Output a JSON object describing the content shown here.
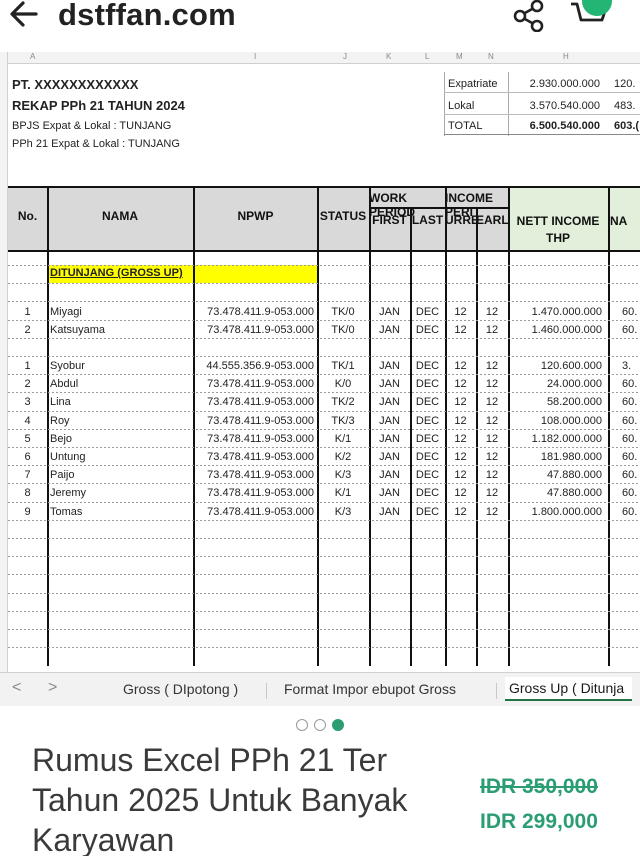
{
  "topbar": {
    "back_icon": "arrow-left-icon",
    "site": "dstffan.com",
    "share_icon": "share-icon",
    "cart_icon": "cart-icon"
  },
  "sheet": {
    "column_letters": [
      "A",
      "I",
      "J",
      "K",
      "L",
      "M",
      "N",
      "H"
    ],
    "company": "PT. XXXXXXXXXXXX",
    "report_title": "REKAP PPh 21 TAHUN 2024",
    "note1": "BPJS Expat & Lokal : TUNJANG",
    "note2": "PPh 21 Expat & Lokal : TUNJANG",
    "summary": [
      {
        "label": "Expatriate",
        "value": "2.930.000.000",
        "value2": "120."
      },
      {
        "label": "Lokal",
        "value": "3.570.540.000",
        "value2": "483."
      },
      {
        "label": "TOTAL",
        "value": "6.500.540.000",
        "value2": "603.("
      }
    ],
    "headers": {
      "no": "No.",
      "nama": "NAMA",
      "npwp": "NPWP",
      "status": "STATUS",
      "work_period": "WORK PERIOD",
      "first": "FIRST",
      "last": "LAST",
      "income_period": "INCOME PERI",
      "current": "URREN",
      "earlier": "EARLI",
      "nett_income": "NETT INCOME",
      "thp": "THP",
      "na": "NA"
    },
    "section_label": "DITUNJANG (GROSS UP)",
    "expat_rows": [
      {
        "no": "1",
        "nama": "Miyagi",
        "npwp": "73.478.411.9-053.000",
        "status": "TK/0",
        "first": "JAN",
        "last": "DEC",
        "cur": "12",
        "earl": "12",
        "nett": "1.470.000.000",
        "na": "60."
      },
      {
        "no": "2",
        "nama": "Katsuyama",
        "npwp": "73.478.411.9-053.000",
        "status": "TK/0",
        "first": "JAN",
        "last": "DEC",
        "cur": "12",
        "earl": "12",
        "nett": "1.460.000.000",
        "na": "60."
      }
    ],
    "local_rows": [
      {
        "no": "1",
        "nama": "Syobur",
        "npwp": "44.555.356.9-053.000",
        "status": "TK/1",
        "first": "JAN",
        "last": "DEC",
        "cur": "12",
        "earl": "12",
        "nett": "120.600.000",
        "na": "3."
      },
      {
        "no": "2",
        "nama": "Abdul",
        "npwp": "73.478.411.9-053.000",
        "status": "K/0",
        "first": "JAN",
        "last": "DEC",
        "cur": "12",
        "earl": "12",
        "nett": "24.000.000",
        "na": "60."
      },
      {
        "no": "3",
        "nama": "Lina",
        "npwp": "73.478.411.9-053.000",
        "status": "TK/2",
        "first": "JAN",
        "last": "DEC",
        "cur": "12",
        "earl": "12",
        "nett": "58.200.000",
        "na": "60."
      },
      {
        "no": "4",
        "nama": "Roy",
        "npwp": "73.478.411.9-053.000",
        "status": "TK/3",
        "first": "JAN",
        "last": "DEC",
        "cur": "12",
        "earl": "12",
        "nett": "108.000.000",
        "na": "60."
      },
      {
        "no": "5",
        "nama": "Bejo",
        "npwp": "73.478.411.9-053.000",
        "status": "K/1",
        "first": "JAN",
        "last": "DEC",
        "cur": "12",
        "earl": "12",
        "nett": "1.182.000.000",
        "na": "60."
      },
      {
        "no": "6",
        "nama": "Untung",
        "npwp": "73.478.411.9-053.000",
        "status": "K/2",
        "first": "JAN",
        "last": "DEC",
        "cur": "12",
        "earl": "12",
        "nett": "181.980.000",
        "na": "60."
      },
      {
        "no": "7",
        "nama": "Paijo",
        "npwp": "73.478.411.9-053.000",
        "status": "K/3",
        "first": "JAN",
        "last": "DEC",
        "cur": "12",
        "earl": "12",
        "nett": "47.880.000",
        "na": "60."
      },
      {
        "no": "8",
        "nama": "Jeremy",
        "npwp": "73.478.411.9-053.000",
        "status": "K/1",
        "first": "JAN",
        "last": "DEC",
        "cur": "12",
        "earl": "12",
        "nett": "47.880.000",
        "na": "60."
      },
      {
        "no": "9",
        "nama": "Tomas",
        "npwp": "73.478.411.9-053.000",
        "status": "K/3",
        "first": "JAN",
        "last": "DEC",
        "cur": "12",
        "earl": "12",
        "nett": "1.800.000.000",
        "na": "60."
      }
    ]
  },
  "tabs": {
    "prev": "<",
    "next": ">",
    "items": [
      "Gross ( DIpotong )",
      "Format Impor ebupot Gross",
      "Gross Up ( Ditunja"
    ]
  },
  "carousel": {
    "count": 3,
    "active": 3
  },
  "product": {
    "title": "Rumus Excel PPh 21 Ter Tahun 2025 Untuk Banyak Karyawan",
    "old_price": "IDR 350,000",
    "new_price": "IDR 299,000"
  }
}
